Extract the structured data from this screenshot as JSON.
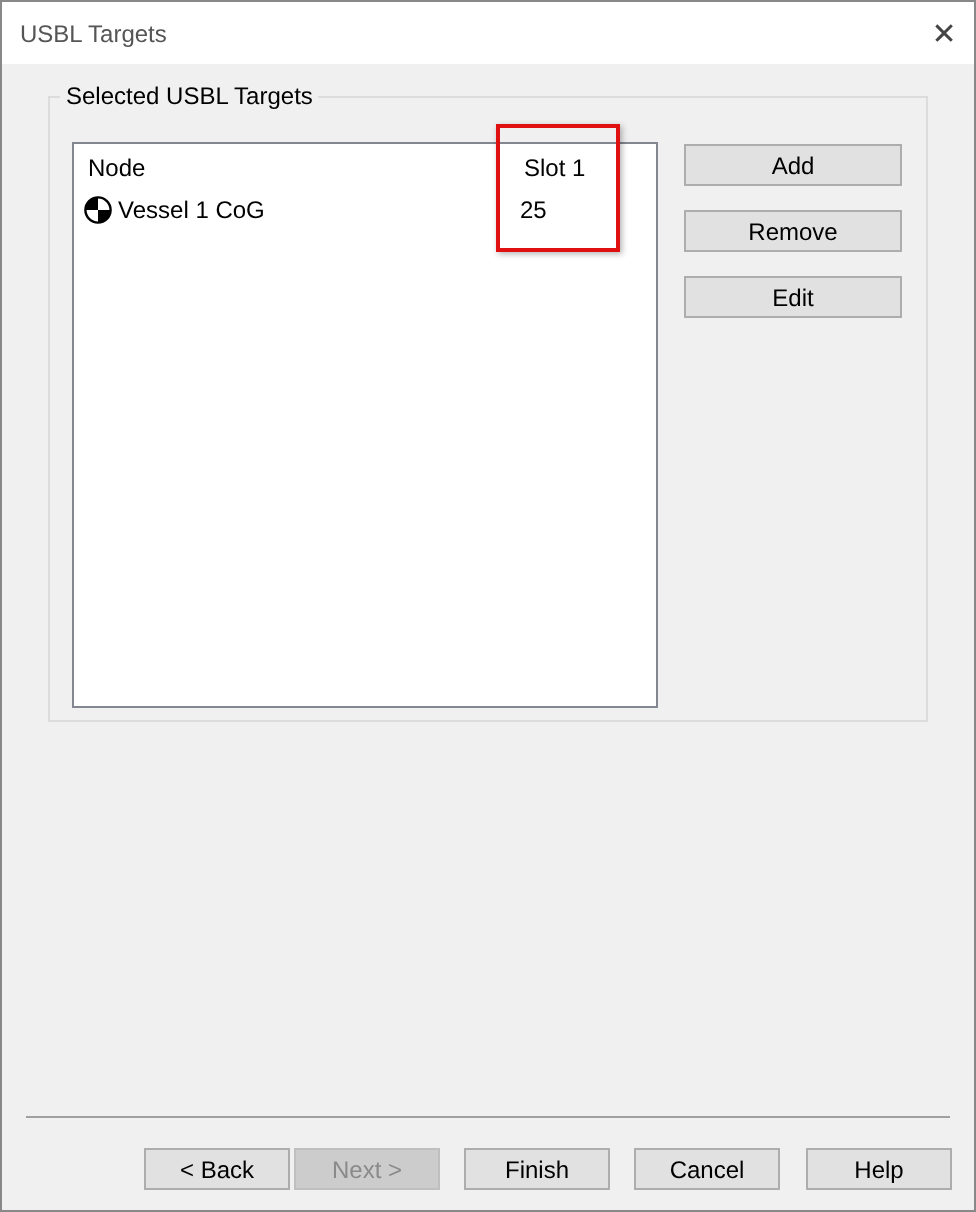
{
  "window": {
    "title": "USBL Targets",
    "close": "✕"
  },
  "group": {
    "title": "Selected USBL Targets",
    "columns": [
      "Node",
      "Slot 1"
    ],
    "rows": [
      {
        "cells": [
          "Vessel 1 CoG",
          "25"
        ],
        "selected": false
      }
    ],
    "buttons": [
      "Add",
      "Remove",
      "Edit"
    ]
  },
  "footer": [
    {
      "label": "< Back",
      "disabled": false
    },
    {
      "label": "Next >",
      "disabled": true
    },
    {
      "label": "Finish",
      "disabled": false
    },
    {
      "label": "Cancel",
      "disabled": false
    },
    {
      "label": "Help",
      "disabled": false
    }
  ]
}
